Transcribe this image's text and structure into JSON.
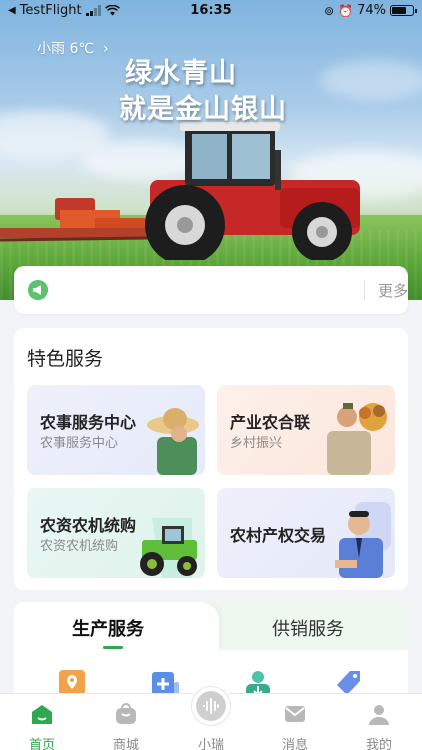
{
  "status_bar": {
    "carrier": "TestFlight",
    "time": "16:35",
    "battery": "74%",
    "battery_level": 0.74
  },
  "hero": {
    "weather": "小雨  6℃",
    "slogan_line1": "绿水青山",
    "slogan_line2": "就是金山银山"
  },
  "notice": {
    "more_label": "更多"
  },
  "featured": {
    "title": "特色服务",
    "tiles": [
      {
        "title": "农事服务中心",
        "subtitle": "农事服务中心"
      },
      {
        "title": "产业农合联",
        "subtitle": "乡村振兴"
      },
      {
        "title": "农资农机统购",
        "subtitle": "农资农机统购"
      },
      {
        "title": "农村产权交易",
        "subtitle": ""
      }
    ]
  },
  "service_tabs": {
    "tabs": [
      "生产服务",
      "供销服务"
    ],
    "active": "生产服务"
  },
  "bottom_nav": {
    "items": [
      "首页",
      "商城",
      "小瑞",
      "消息",
      "我的"
    ],
    "active": "首页"
  },
  "colors": {
    "accent": "#2fa850",
    "tile_blue": "#eef1fb",
    "tile_peach": "#fdf1ea",
    "tile_mint": "#e9f7f4",
    "tile_lavender": "#eef0fb"
  }
}
